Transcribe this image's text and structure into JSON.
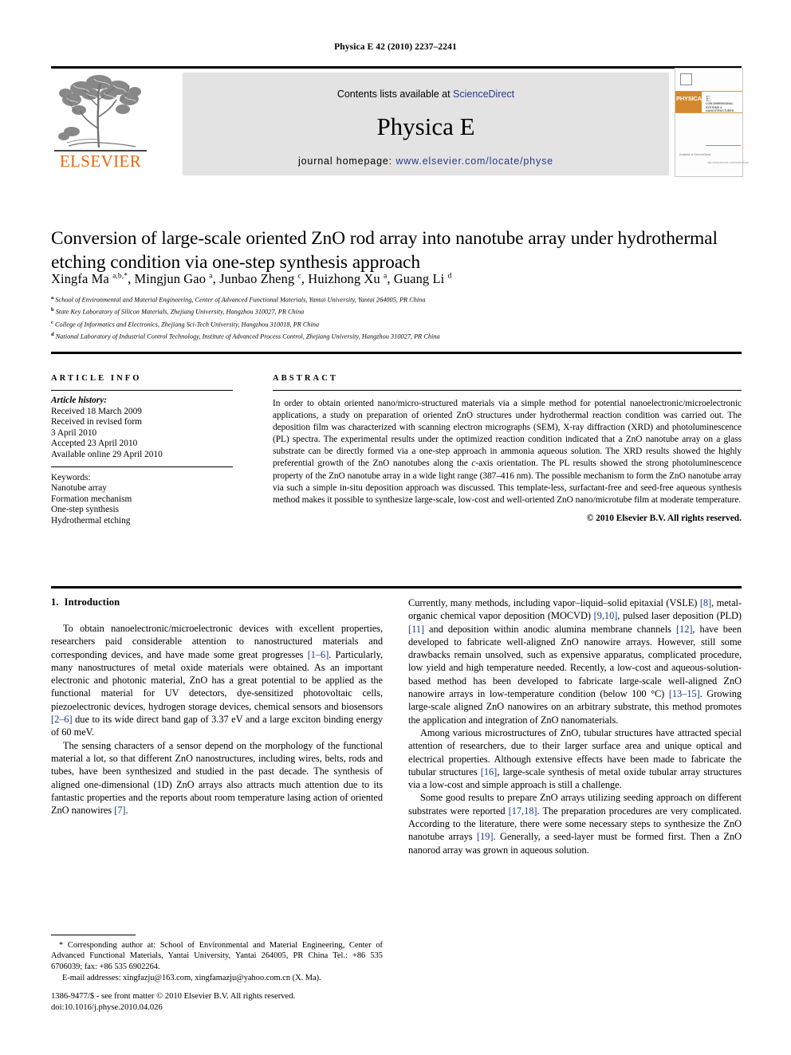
{
  "running_head": "Physica E 42 (2010) 2237–2241",
  "banner": {
    "contents_prefix": "Contents lists available at ",
    "sciencedirect": "ScienceDirect",
    "journal_title": "Physica E",
    "homepage_prefix": "journal homepage: ",
    "homepage_url": "www.elsevier.com/locate/physe",
    "publisher_wordmark": "ELSEVIER",
    "link_color": "#2a3b8f",
    "elsevier_orange": "#eb6608",
    "cover": {
      "band_title": "PHYSICA",
      "band_letter": "E",
      "band_subtitle": "LOW-DIMENSIONAL SYSTEMS & NANOSTRUCTURES",
      "footer_left": "Available at\nScienceDirect",
      "footer_right": "http://www.elsevier.com/locate/physe"
    }
  },
  "article": {
    "title": "Conversion of large-scale oriented ZnO rod array into nanotube array under hydrothermal etching condition via one-step synthesis approach",
    "authors_html": "Xingfa Ma <sup>a,b,</sup><sup>*</sup>, Mingjun Gao <sup>a</sup>, Junbao Zheng <sup>c</sup>, Huizhong Xu <sup>a</sup>, Guang Li <sup>d</sup>",
    "affiliations": [
      {
        "marker": "a",
        "text": "School of Environmental and Material Engineering, Center of Advanced Functional Materials, Yantai University, Yantai 264005, PR China"
      },
      {
        "marker": "b",
        "text": "State Key Laboratory of Silicon Materials, Zhejiang University, Hangzhou 310027, PR China"
      },
      {
        "marker": "c",
        "text": "College of Informatics and Electronics, Zhejiang Sci-Tech University, Hangzhou 310018, PR China"
      },
      {
        "marker": "d",
        "text": "National Laboratory of Industrial Control Technology, Institute of Advanced Process Control, Zhejiang University, Hangzhou 310027, PR China"
      }
    ]
  },
  "article_info": {
    "heading": "ARTICLE INFO",
    "history_label": "Article history:",
    "history_lines": [
      "Received 18 March 2009",
      "Received in revised form",
      "3 April 2010",
      "Accepted 23 April 2010",
      "Available online 29 April 2010"
    ],
    "keywords_label": "Keywords:",
    "keywords": [
      "Nanotube array",
      "Formation mechanism",
      "One-step synthesis",
      "Hydrothermal etching"
    ]
  },
  "abstract": {
    "heading": "ABSTRACT",
    "text_part1": "In order to obtain oriented nano/micro-structured materials via a simple method for potential nanoelectronic/microelectronic applications, a study on preparation of oriented ZnO structures under hydrothermal reaction condition was carried out. The deposition film was characterized with scanning electron micrographs (SEM), X-ray diffraction (XRD) and photoluminescence (PL) spectra. The experimental results under the optimized reaction condition indicated that a ZnO nanotube array on a glass substrate can be directly formed via a one-step approach in ammonia aqueous solution. The XRD results showed the highly preferential growth of the ZnO nanotubes along the ",
    "italic_caxis": "c",
    "text_part2": "-axis orientation. The PL results showed the strong photoluminescence property of the ZnO nanotube array in a wide light range (387–416 nm). The possible mechanism to form the ZnO nanotube array via such a simple in-situ deposition approach was discussed. This template-less, surfactant-free and seed-free aqueous synthesis method makes it possible to synthesize large-scale, low-cost and well-oriented ZnO nano/microtube film at moderate temperature.",
    "copyright": "© 2010 Elsevier B.V. All rights reserved."
  },
  "body": {
    "section_number": "1.",
    "section_title": "Introduction",
    "left_paragraphs": [
      {
        "segments": [
          {
            "t": "To obtain nanoelectronic/microelectronic devices with excellent properties, researchers paid considerable attention to nanostructured materials and corresponding devices, and have made some great progresses "
          },
          {
            "t": "[1–6]",
            "ref": true
          },
          {
            "t": ". Particularly, many nanostructures of metal oxide materials were obtained. As an important electronic and photonic material, ZnO has a great potential to be applied as the functional material for UV detectors, dye-sensitized photovoltaic cells, piezoelectronic devices, hydrogen storage devices, chemical sensors and biosensors "
          },
          {
            "t": "[2–6]",
            "ref": true
          },
          {
            "t": " due to its wide direct band gap of 3.37 eV and a large exciton binding energy of 60 meV."
          }
        ]
      },
      {
        "segments": [
          {
            "t": "The sensing characters of a sensor depend on the morphology of the functional material a lot, so that different ZnO nanostructures, including wires, belts, rods and tubes, have been synthesized and studied in the past decade. The synthesis of aligned one-dimensional (1D) ZnO arrays also attracts much attention due to its fantastic properties and the reports about room temperature lasing action of oriented ZnO nanowires "
          },
          {
            "t": "[7]",
            "ref": true
          },
          {
            "t": "."
          }
        ]
      }
    ],
    "right_paragraphs": [
      {
        "noindent": true,
        "segments": [
          {
            "t": "Currently, many methods, including vapor–liquid–solid epitaxial (VSLE) "
          },
          {
            "t": "[8]",
            "ref": true
          },
          {
            "t": ", metal-organic chemical vapor deposition (MOCVD) "
          },
          {
            "t": "[9,10]",
            "ref": true
          },
          {
            "t": ", pulsed laser deposition (PLD) "
          },
          {
            "t": "[11]",
            "ref": true
          },
          {
            "t": " and deposition within anodic alumina membrane channels "
          },
          {
            "t": "[12]",
            "ref": true
          },
          {
            "t": ", have been developed to fabricate well-aligned ZnO nanowire arrays. However, still some drawbacks remain unsolved, such as expensive apparatus, complicated procedure, low yield and high temperature needed. Recently, a low-cost and aqueous-solution-based method has been developed to fabricate large-scale well-aligned ZnO nanowire arrays in low-temperature condition (below 100 °C) "
          },
          {
            "t": "[13–15]",
            "ref": true
          },
          {
            "t": ". Growing large-scale aligned ZnO nanowires on an arbitrary substrate, this method promotes the application and integration of ZnO nanomaterials."
          }
        ]
      },
      {
        "segments": [
          {
            "t": "Among various microstructures of ZnO, tubular structures have attracted special attention of researchers, due to their larger surface area and unique optical and electrical properties. Although extensive effects have been made to fabricate the tubular structures "
          },
          {
            "t": "[16]",
            "ref": true
          },
          {
            "t": ", large-scale synthesis of metal oxide tubular array structures via a low-cost and simple approach is still a challenge."
          }
        ]
      },
      {
        "segments": [
          {
            "t": "Some good results to prepare ZnO arrays utilizing seeding approach on different substrates were reported "
          },
          {
            "t": "[17,18]",
            "ref": true
          },
          {
            "t": ". The preparation procedures are very complicated. According to the literature, there were some necessary steps to synthesize the ZnO nanotube arrays "
          },
          {
            "t": "[19]",
            "ref": true
          },
          {
            "t": ". Generally, a seed-layer must be formed first. Then a ZnO nanorod array was grown in aqueous solution."
          }
        ]
      }
    ]
  },
  "footnotes": {
    "corresponding": "* Corresponding author at: School of Environmental and Material Engineering, Center of Advanced Functional Materials, Yantai University, Yantai 264005, PR China Tel.: +86 535 6706039; fax: +86 535 6902264.",
    "email_label": "E-mail addresses:",
    "email_text": " xingfazju@163.com, xingfamazju@yahoo.com.cn (X. Ma)."
  },
  "imprint": {
    "line1": "1386-9477/$ - see front matter © 2010 Elsevier B.V. All rights reserved.",
    "line2": "doi:10.1016/j.physe.2010.04.026"
  }
}
